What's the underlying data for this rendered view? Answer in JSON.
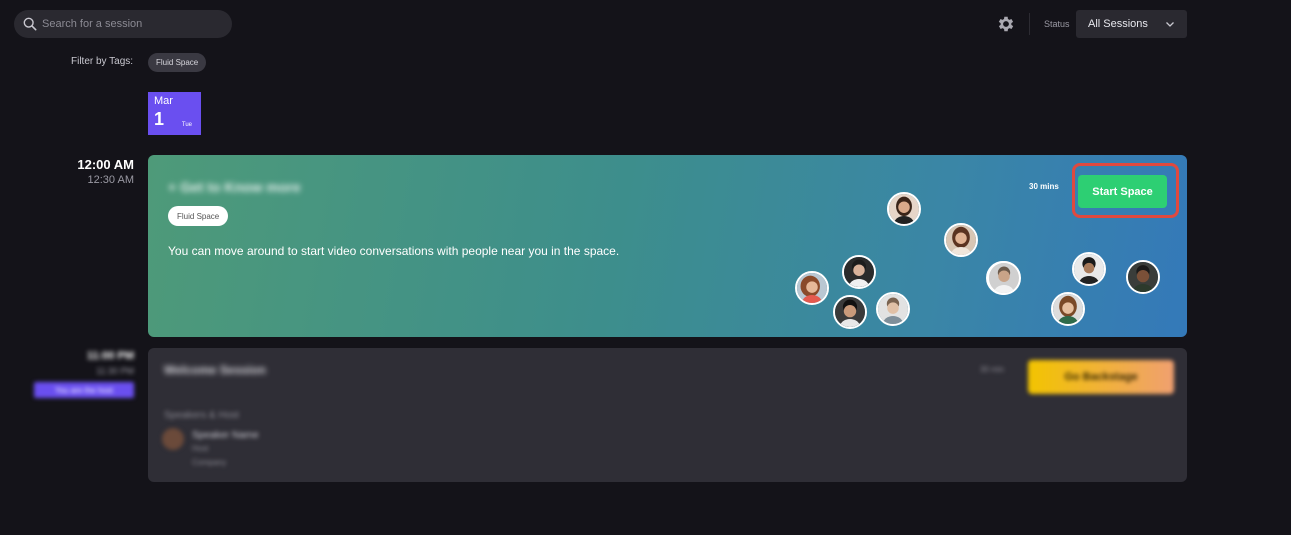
{
  "search": {
    "placeholder": "Search for a session"
  },
  "status": {
    "label": "Status",
    "selected": "All Sessions"
  },
  "filter": {
    "label": "Filter by Tags:",
    "tags": [
      "Fluid Space"
    ]
  },
  "date": {
    "month": "Mar",
    "day": "1",
    "weekday": "Tue"
  },
  "sessions": [
    {
      "start_time": "12:00 AM",
      "end_time": "12:30 AM",
      "title": "+ Get to Know more",
      "tag": "Fluid Space",
      "description": "You can move around to start video conversations with people near you in the space.",
      "duration": "30 mins",
      "action_label": "Start Space"
    },
    {
      "start_time": "11:00 PM",
      "end_time": "11:30 PM",
      "host_badge": "You are the host",
      "title": "Welcome Session",
      "duration": "30 min",
      "action_label": "Go Backstage",
      "speakers_label": "Speakers & Host",
      "speaker_name": "Speaker Name",
      "speaker_role": "Host",
      "speaker_company": "Company"
    }
  ],
  "colors": {
    "accent": "#6a4ff0",
    "start_button": "#2dcf73",
    "highlight": "#e0493f"
  }
}
